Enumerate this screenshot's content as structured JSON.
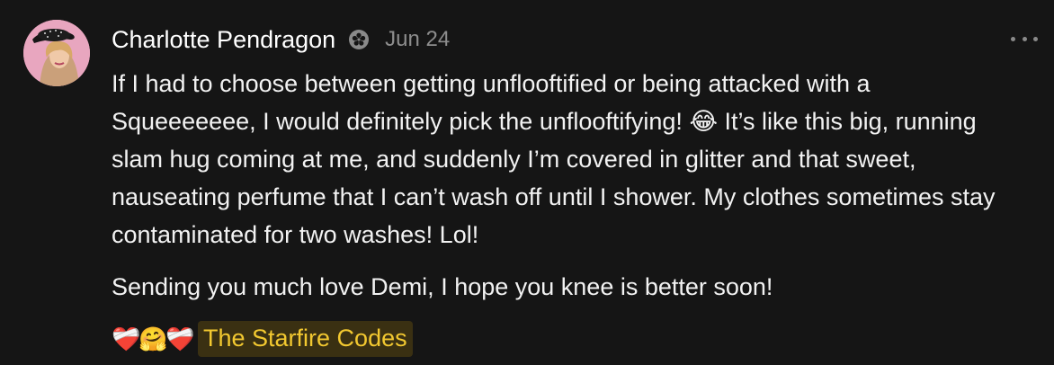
{
  "post": {
    "author": "Charlotte Pendragon",
    "date": "Jun 24",
    "badge_icon": "verified-flower-icon",
    "paragraph1_a": "If I had to choose between getting unflooftified or being attacked with a Squeeeeeee, I would definitely pick the unflooftifying!",
    "paragraph1_emoji": "😂",
    "paragraph1_b": " It’s like this big, running slam hug coming at me, and suddenly I’m covered in glitter and that sweet, nauseating perfume that I can’t wash off until I shower. My clothes sometimes stay contaminated for two washes! Lol!",
    "paragraph2": "Sending you much love Demi, I hope you knee is better soon!",
    "signature_emoji_1": "❤️‍🩹",
    "signature_emoji_2": "🤗",
    "signature_emoji_3": "❤️‍🩹",
    "signature_text": "The Starfire Codes"
  },
  "colors": {
    "background": "#151515",
    "text": "#f2f2f2",
    "muted": "#8d8d8d",
    "highlight_bg": "#3a3012",
    "highlight_text": "#f2c830"
  }
}
